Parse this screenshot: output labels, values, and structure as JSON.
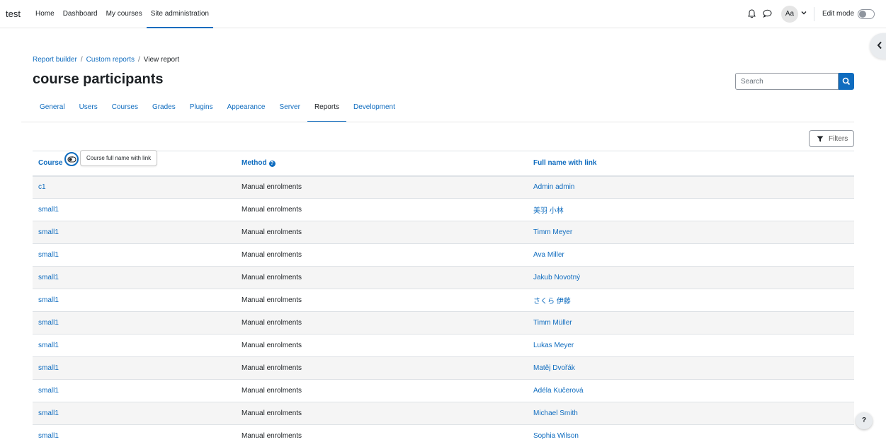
{
  "site": {
    "name": "test"
  },
  "primary_nav": [
    {
      "label": "Home"
    },
    {
      "label": "Dashboard"
    },
    {
      "label": "My courses"
    },
    {
      "label": "Site administration"
    }
  ],
  "user": {
    "initials": "Aa"
  },
  "edit_mode": {
    "label": "Edit mode",
    "enabled": false
  },
  "breadcrumb": [
    {
      "label": "Report builder"
    },
    {
      "label": "Custom reports"
    },
    {
      "label": "View report"
    }
  ],
  "page_title": "course participants",
  "search": {
    "placeholder": "Search"
  },
  "secondary_nav": [
    {
      "label": "General"
    },
    {
      "label": "Users"
    },
    {
      "label": "Courses"
    },
    {
      "label": "Grades"
    },
    {
      "label": "Plugins"
    },
    {
      "label": "Appearance"
    },
    {
      "label": "Server"
    },
    {
      "label": "Reports"
    },
    {
      "label": "Development"
    }
  ],
  "filters": {
    "label": "Filters"
  },
  "table": {
    "headers": {
      "course": "Course",
      "course_tooltip": "Course full name with link",
      "method": "Method",
      "fullname": "Full name with link"
    },
    "rows": [
      {
        "course": "c1",
        "method": "Manual enrolments",
        "fullname": "Admin admin"
      },
      {
        "course": "small1",
        "method": "Manual enrolments",
        "fullname": "美羽 小林"
      },
      {
        "course": "small1",
        "method": "Manual enrolments",
        "fullname": "Timm Meyer"
      },
      {
        "course": "small1",
        "method": "Manual enrolments",
        "fullname": "Ava Miller"
      },
      {
        "course": "small1",
        "method": "Manual enrolments",
        "fullname": "Jakub Novotný"
      },
      {
        "course": "small1",
        "method": "Manual enrolments",
        "fullname": "さくら 伊藤"
      },
      {
        "course": "small1",
        "method": "Manual enrolments",
        "fullname": "Timm Müller"
      },
      {
        "course": "small1",
        "method": "Manual enrolments",
        "fullname": "Lukas Meyer"
      },
      {
        "course": "small1",
        "method": "Manual enrolments",
        "fullname": "Matěj Dvořák"
      },
      {
        "course": "small1",
        "method": "Manual enrolments",
        "fullname": "Adéla Kučerová"
      },
      {
        "course": "small1",
        "method": "Manual enrolments",
        "fullname": "Michael Smith"
      },
      {
        "course": "small1",
        "method": "Manual enrolments",
        "fullname": "Sophia Wilson"
      }
    ]
  },
  "help_button": {
    "label": "?"
  },
  "colors": {
    "accent": "#0f6cbf",
    "text": "#1d2125",
    "stripe": "#f5f5f5"
  }
}
